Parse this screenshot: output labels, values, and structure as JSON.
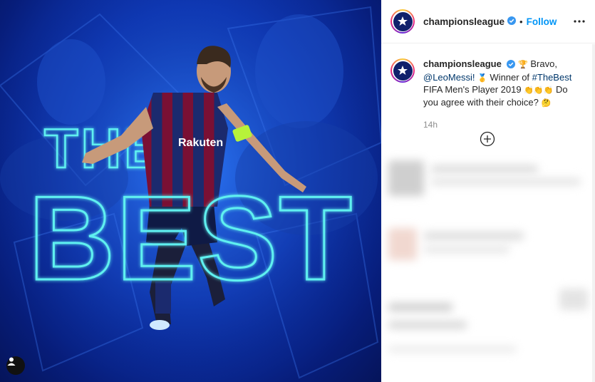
{
  "post": {
    "image_text_line1": "THE",
    "image_text_line2": "BEST",
    "jersey_sponsor": "Rakuten",
    "colors": {
      "bg_dark": "#071d7a",
      "bg_light": "#1f63e6",
      "neon": "#4de3e6"
    },
    "user_tag_icon": "user-icon"
  },
  "header": {
    "username": "championsleague",
    "separator": "•",
    "follow_label": "Follow",
    "more_icon": "more-horizontal-icon",
    "verified_icon": "verified-badge-icon"
  },
  "caption": {
    "username": "championsleague",
    "part1": "Bravo,",
    "mention": "@LeoMessi!",
    "part2": "Winner of",
    "hashtag": "#TheBest",
    "part3": "FIFA Men's Player 2019",
    "part4": "Do you agree with their choice?",
    "time": "14h",
    "trophy_emoji": "🏆",
    "medal_emoji": "🥇",
    "clap_emoji": "👏👏👏",
    "think_emoji": "🤔"
  },
  "comments": {
    "load_more_icon": "plus-circle-icon"
  },
  "colors": {
    "accent": "#0095f6",
    "link": "#00376b",
    "muted": "#8e8e8e"
  }
}
